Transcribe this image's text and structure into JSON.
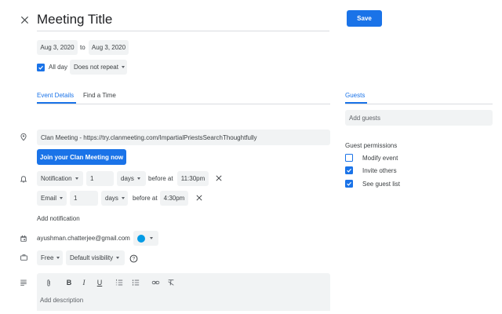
{
  "header": {
    "title": "Meeting Title",
    "save_label": "Save"
  },
  "dates": {
    "start": "Aug 3, 2020",
    "separator": "to",
    "end": "Aug 3, 2020",
    "all_day_label": "All day",
    "all_day_checked": true,
    "repeat": "Does not repeat"
  },
  "tabs": {
    "event_details": "Event Details",
    "find_time": "Find a Time",
    "guests": "Guests"
  },
  "location": {
    "value": "Clan Meeting - https://try.clanmeeting.com/ImpartialPriestsSearchThoughtfully",
    "join_label": "Join your Clan Meeting now"
  },
  "notifications": [
    {
      "type": "Notification",
      "amount": "1",
      "unit": "days",
      "before_label": "before at",
      "time": "11:30pm"
    },
    {
      "type": "Email",
      "amount": "1",
      "unit": "days",
      "before_label": "before at",
      "time": "4:30pm"
    }
  ],
  "add_notification_label": "Add notification",
  "calendar": {
    "owner": "ayushman.chatterjee@gmail.com",
    "color": "#039be5"
  },
  "availability": {
    "status": "Free",
    "visibility": "Default visibility"
  },
  "description": {
    "placeholder": "Add description"
  },
  "guests": {
    "placeholder": "Add guests",
    "permissions_title": "Guest permissions",
    "permissions": [
      {
        "label": "Modify event",
        "checked": false
      },
      {
        "label": "Invite others",
        "checked": true
      },
      {
        "label": "See guest list",
        "checked": true
      }
    ]
  },
  "colors": {
    "accent": "#1a73e8",
    "field_bg": "#f1f3f4"
  }
}
